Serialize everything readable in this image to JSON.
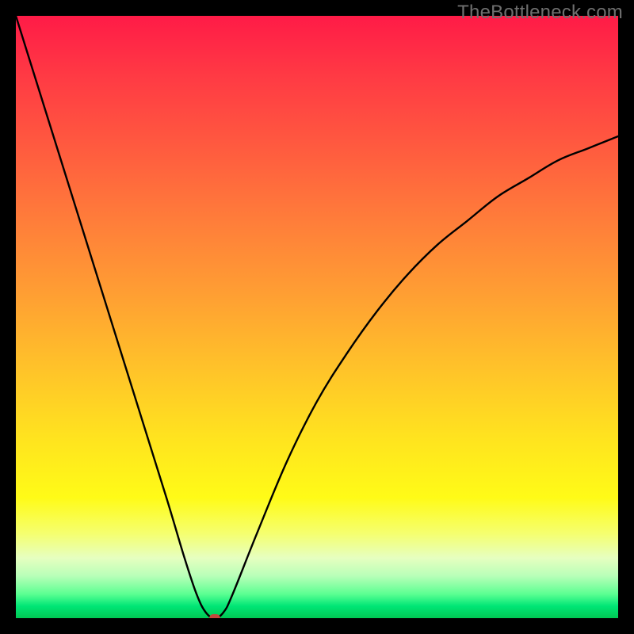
{
  "watermark": "TheBottleneck.com",
  "chart_data": {
    "type": "line",
    "title": "",
    "xlabel": "",
    "ylabel": "",
    "xlim": [
      0,
      100
    ],
    "ylim": [
      0,
      100
    ],
    "series": [
      {
        "name": "bottleneck-curve",
        "x": [
          0,
          5,
          10,
          15,
          20,
          25,
          28,
          30,
          31.5,
          33,
          34.5,
          36,
          40,
          45,
          50,
          55,
          60,
          65,
          70,
          75,
          80,
          85,
          90,
          95,
          100
        ],
        "y": [
          100,
          84,
          68,
          52,
          36,
          20,
          10,
          4,
          1,
          0,
          1,
          4,
          14,
          26,
          36,
          44,
          51,
          57,
          62,
          66,
          70,
          73,
          76,
          78,
          80
        ]
      }
    ],
    "marker": {
      "x": 33,
      "y": 0,
      "color": "#c3463c"
    }
  },
  "colors": {
    "border": "#000000",
    "curve": "#000000",
    "watermark": "#6f6f6f",
    "marker": "#c3463c"
  }
}
